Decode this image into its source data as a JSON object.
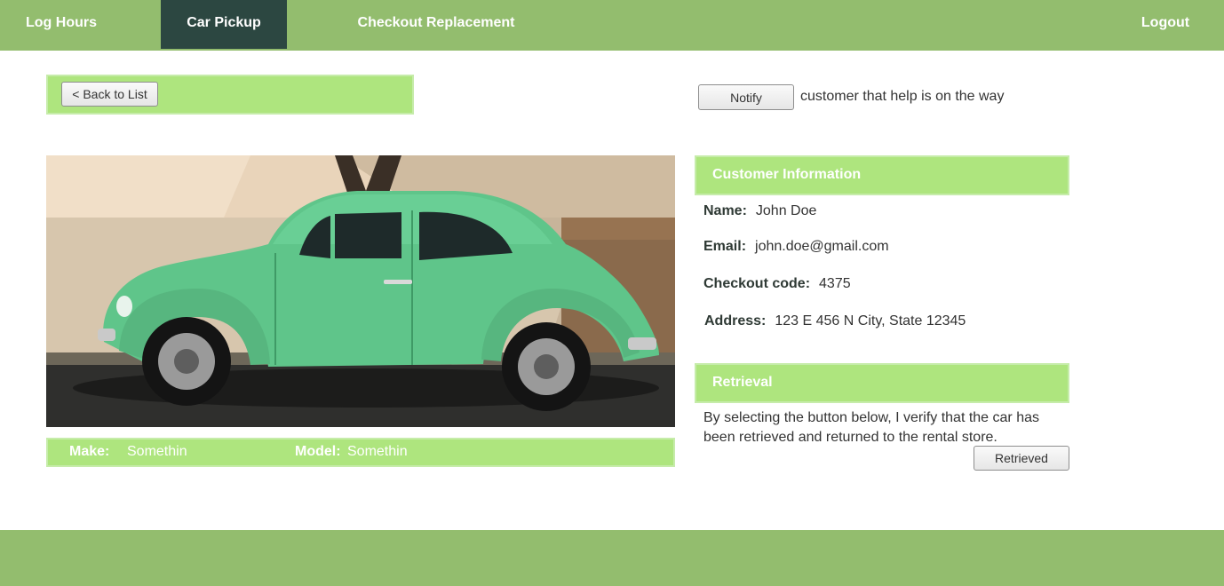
{
  "nav": {
    "log_hours": "Log Hours",
    "car_pickup": "Car Pickup",
    "checkout_replacement": "Checkout Replacement",
    "logout": "Logout"
  },
  "back_button": "< Back to List",
  "notify": {
    "button": "Notify",
    "text": "customer that help is on the way"
  },
  "car": {
    "make_label": "Make:",
    "make_value": "Somethin",
    "model_label": "Model:",
    "model_value": "Somethin"
  },
  "customer": {
    "header": "Customer Information",
    "name_label": "Name:",
    "name_value": "John Doe",
    "email_label": "Email:",
    "email_value": "john.doe@gmail.com",
    "code_label": "Checkout code:",
    "code_value": "4375",
    "address_label": "Address:",
    "address_value": "123 E 456 N City, State 12345"
  },
  "retrieval": {
    "header": "Retrieval",
    "text": "By selecting the button below, I verify that the car has been retrieved and returned to the rental store.",
    "button": "Retrieved"
  },
  "colors": {
    "nav_bg": "#93bd6e",
    "nav_active": "#2c4741",
    "panel_green": "#aee57e",
    "car_green": "#5fc58a"
  }
}
